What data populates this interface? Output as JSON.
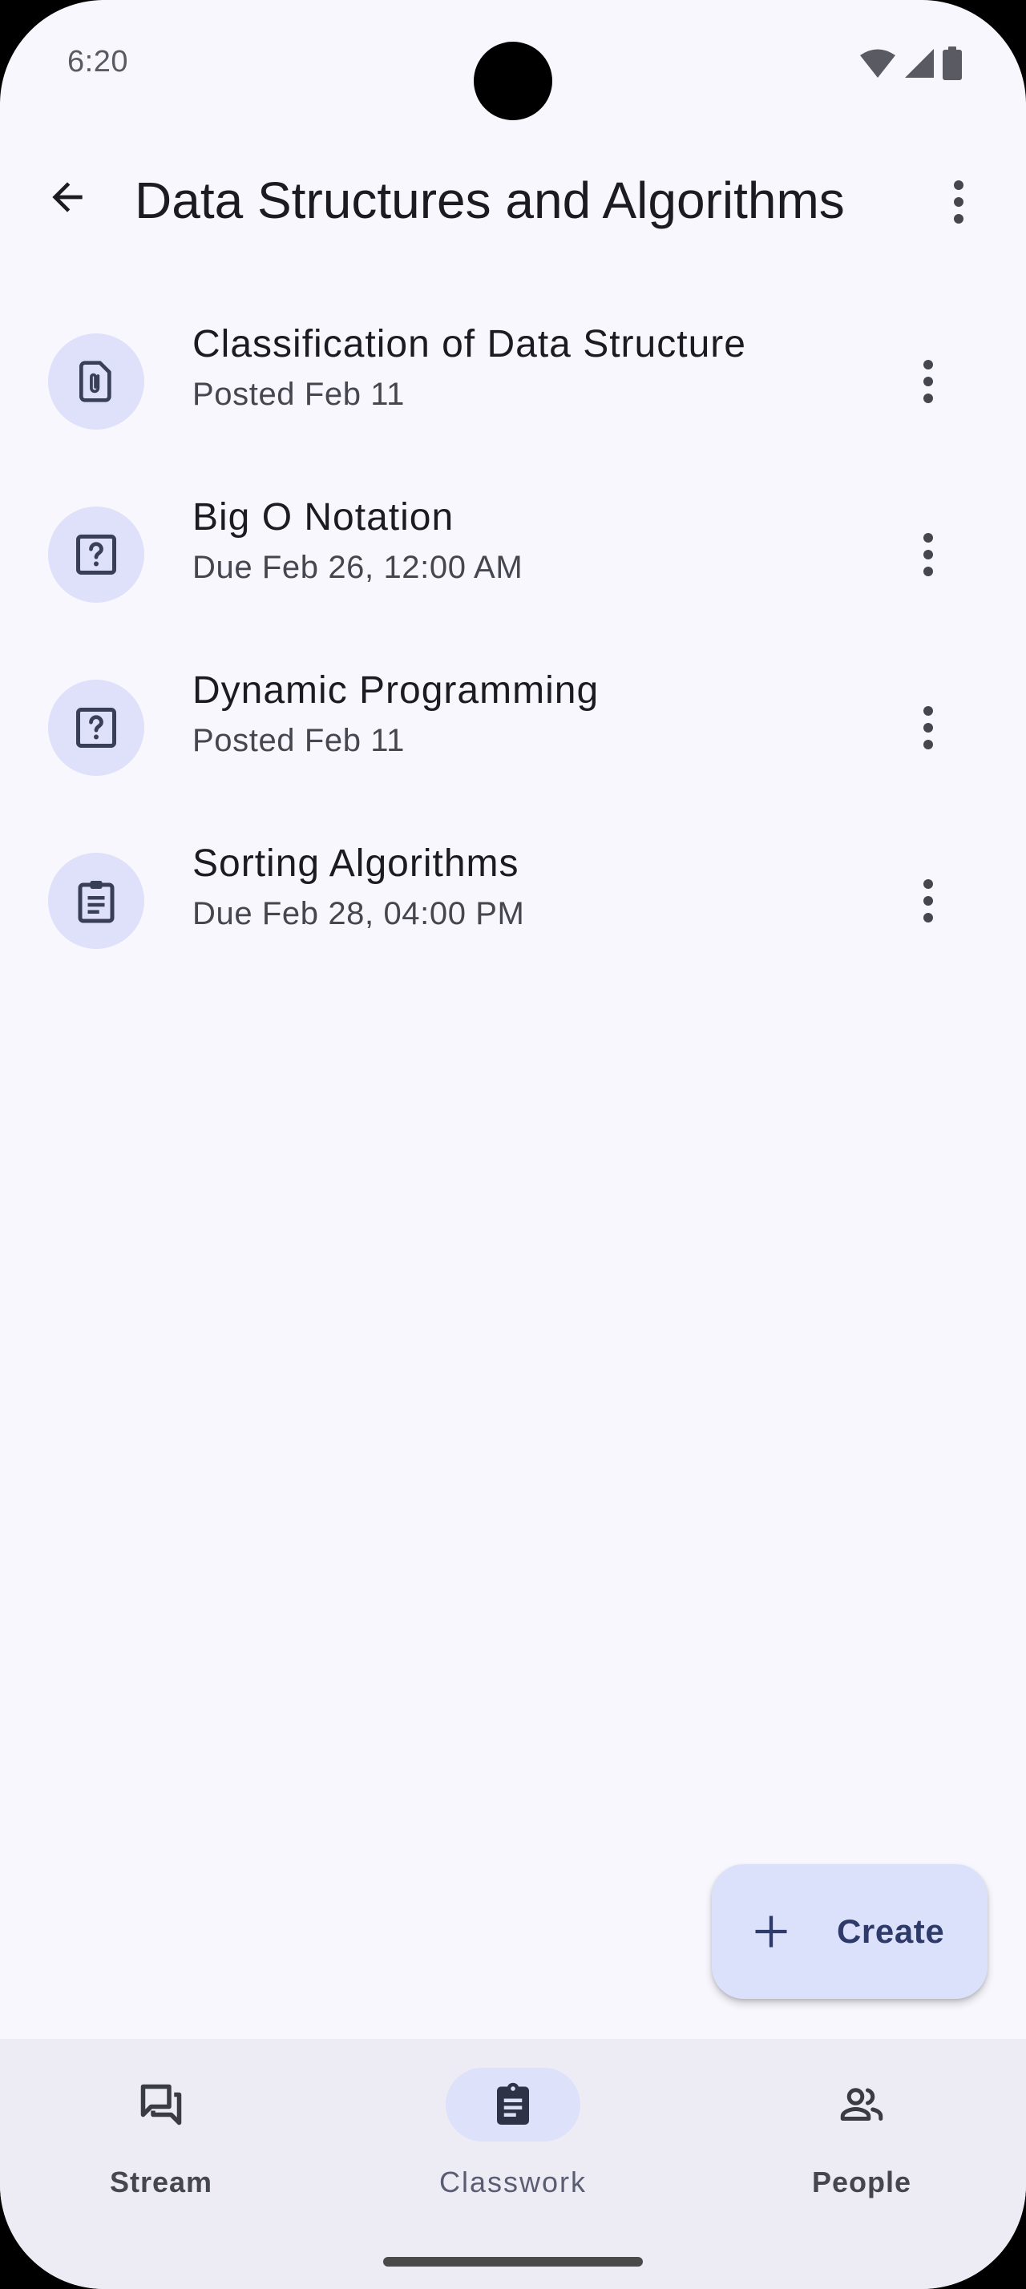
{
  "status_bar": {
    "time": "6:20"
  },
  "app_bar": {
    "title": "Data Structures and Algorithms",
    "back_icon": "arrow-back-icon",
    "menu_icon": "more-vert-icon"
  },
  "classwork": [
    {
      "title": "Classification of Data Structure",
      "subtitle": "Posted Feb 11",
      "icon": "attachment-file-icon"
    },
    {
      "title": "Big O Notation",
      "subtitle": "Due Feb 26, 12:00 AM",
      "icon": "question-icon"
    },
    {
      "title": "Dynamic Programming",
      "subtitle": "Posted Feb 11",
      "icon": "question-icon"
    },
    {
      "title": "Sorting Algorithms",
      "subtitle": "Due Feb 28, 04:00 PM",
      "icon": "assignment-icon"
    }
  ],
  "fab": {
    "label": "Create",
    "icon": "plus-icon"
  },
  "bottom_nav": {
    "items": [
      {
        "label": "Stream",
        "icon": "forum-icon",
        "active": false
      },
      {
        "label": "Classwork",
        "icon": "assignment-icon",
        "active": true
      },
      {
        "label": "People",
        "icon": "people-icon",
        "active": false
      }
    ]
  },
  "colors": {
    "background": "#f8f7fe",
    "icon_circle": "#dee1f9",
    "fab": "#dbe1fb",
    "nav_bar": "#edecf4",
    "text_primary": "#1b1b21",
    "text_secondary": "#46464f"
  }
}
